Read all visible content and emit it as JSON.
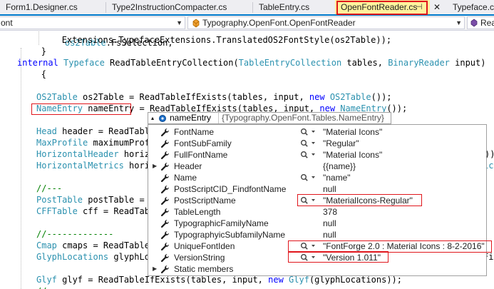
{
  "tabs": [
    {
      "label": "Form1.Designer.cs",
      "active": false
    },
    {
      "label": "Type2InstructionCompacter.cs",
      "active": false
    },
    {
      "label": "TableEntry.cs",
      "active": false
    },
    {
      "label": "OpenFontReader.cs",
      "active": true,
      "pin": "⊣",
      "close": "✕"
    },
    {
      "label": "Typeface.cs",
      "active": false
    }
  ],
  "navbar": {
    "project": "ont",
    "type_icon": "class-icon",
    "type": "Typography.OpenFont.OpenFontReader",
    "member": "Rea"
  },
  "code": {
    "line0": "            Extensions.TypefaceExtensions.TranslatedOS2FontStyle(os2Table));",
    "line1": "        }",
    "line2_kw": "internal",
    "line2_ty": "Typeface",
    "line2_rest": " ReadTableEntryCollection(",
    "line2_ty2": "TableEntryCollection",
    "line2_rest2": " tables, ",
    "line2_ty3": "BinaryReader",
    "line2_rest3": " input)",
    "line3": "        {",
    "l_os2_ty": "OS2Table",
    "l_os2": " os2Table = ReadTableIfExists(tables, input, ",
    "l_os2_kw": "new",
    "l_os2_ty2": "OS2Table",
    "l_os2_end": "());",
    "l_ne_ty": "NameEntry",
    "l_ne": " nameEntry = ReadTableIfExists(tables, input, ",
    "l_ne_kw": "new",
    "l_ne_ty2": "NameEntry",
    "l_ne_end": "());",
    "l_head_ty": "Head",
    "l_head": " header = ReadTabl",
    "l_maxp_ty": "MaxProfile",
    "l_maxp": " maximumProf",
    "l_hh_ty": "HorizontalHeader",
    "l_hh": " horiz",
    "l_hh_end": "))",
    "l_hm_ty": "HorizontalMetrics",
    "l_hm": " hori",
    "l_hm_end": "ics",
    "l_c1": "//---",
    "l_post_ty": "PostTable",
    "l_post": " postTable = ",
    "l_cff_ty": "CFFTable",
    "l_cff": " cff = ReadTab",
    "l_c2": "//-------------",
    "l_cmap_ty": "Cmap",
    "l_cmap": " cmaps = ReadTable",
    "l_glyp_ty": "GlyphLocations",
    "l_glyp": " glyphLoc",
    "l_glyp_end": "Fi",
    "l_glyf_ty": "Glyf",
    "l_glyf": " glyf = ReadTableIfExists(tables, input, ",
    "l_glyf_kw": "new",
    "l_glyf_ty2": "Glyf",
    "l_glyf_end": "(glyphLocations));",
    "l_last": "//"
  },
  "datatip": {
    "header_name": "nameEntry",
    "header_value": "{Typography.OpenFont.Tables.NameEntry}",
    "rows": [
      {
        "name": "FontName",
        "value": "\"Material Icons\"",
        "viewer": true,
        "expandable": false
      },
      {
        "name": "FontSubFamily",
        "value": "\"Regular\"",
        "viewer": true,
        "expandable": false
      },
      {
        "name": "FullFontName",
        "value": "\"Material Icons\"",
        "viewer": true,
        "expandable": false
      },
      {
        "name": "Header",
        "value": "{{name}}",
        "viewer": false,
        "expandable": true
      },
      {
        "name": "Name",
        "value": "\"name\"",
        "viewer": true,
        "expandable": false
      },
      {
        "name": "PostScriptCID_FindfontName",
        "value": "null",
        "viewer": false,
        "expandable": false
      },
      {
        "name": "PostScriptName",
        "value": "\"MaterialIcons-Regular\"",
        "viewer": true,
        "expandable": false
      },
      {
        "name": "TableLength",
        "value": "378",
        "viewer": false,
        "expandable": false
      },
      {
        "name": "TypographicFamilyName",
        "value": "null",
        "viewer": false,
        "expandable": false
      },
      {
        "name": "TypographyicSubfamilyName",
        "value": "null",
        "viewer": false,
        "expandable": false
      },
      {
        "name": "UniqueFontIden",
        "value": "\"FontForge 2.0 : Material Icons : 8-2-2016\"",
        "viewer": true,
        "expandable": false
      },
      {
        "name": "VersionString",
        "value": "\"Version 1.011\"",
        "viewer": true,
        "expandable": false
      },
      {
        "name": "Static members",
        "value": "",
        "viewer": false,
        "expandable": true
      }
    ]
  },
  "colors": {
    "highlight_box": "#e0161c",
    "active_tab": "#fff29d",
    "keyword": "#0000ff",
    "type": "#2b91af",
    "comment": "#008000"
  }
}
